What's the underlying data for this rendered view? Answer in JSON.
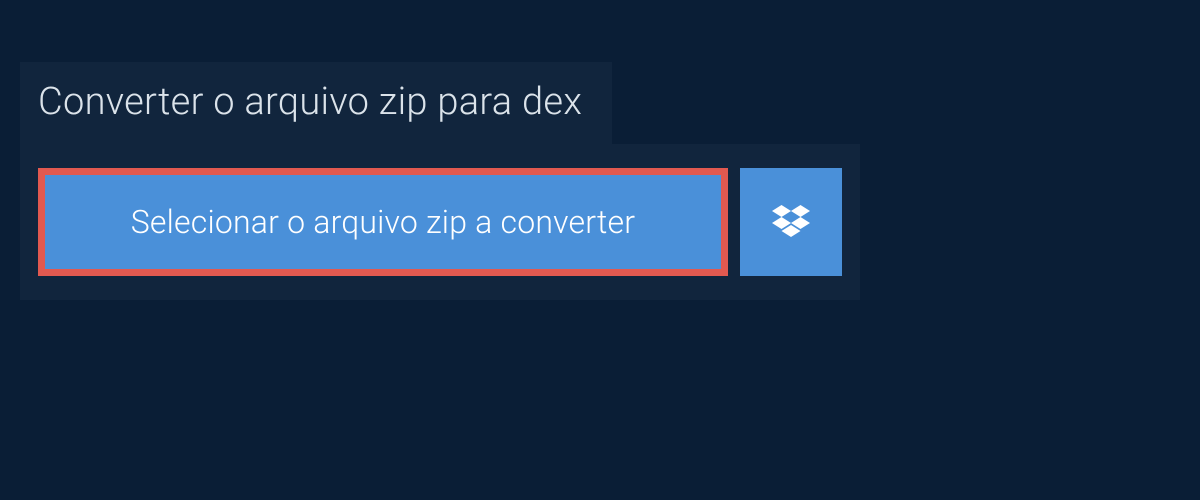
{
  "header": {
    "title": "Converter o arquivo zip para dex"
  },
  "buttons": {
    "select_file_label": "Selecionar o arquivo zip a converter",
    "dropbox_icon_name": "dropbox"
  },
  "colors": {
    "page_bg": "#0a1e36",
    "panel_bg": "#11253d",
    "button_bg": "#4a90d9",
    "highlight_border": "#e15950",
    "text_light": "#dbe3ea",
    "text_white": "#ffffff"
  }
}
